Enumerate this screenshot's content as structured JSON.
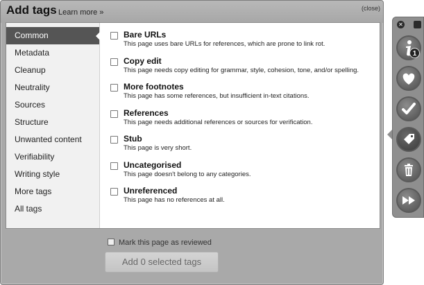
{
  "panel": {
    "title": "Add tags",
    "learn_more": "Learn more »",
    "close_label": "(close)"
  },
  "menu": {
    "items": [
      {
        "label": "Common",
        "active": true
      },
      {
        "label": "Metadata"
      },
      {
        "label": "Cleanup"
      },
      {
        "label": "Neutrality"
      },
      {
        "label": "Sources"
      },
      {
        "label": "Structure"
      },
      {
        "label": "Unwanted content"
      },
      {
        "label": "Verifiability"
      },
      {
        "label": "Writing style"
      },
      {
        "label": "More tags"
      },
      {
        "label": "All tags"
      }
    ]
  },
  "tags": [
    {
      "name": "Bare URLs",
      "desc": "This page uses bare URLs for references, which are prone to link rot."
    },
    {
      "name": "Copy edit",
      "desc": "This page needs copy editing for grammar, style, cohesion, tone, and/or spelling."
    },
    {
      "name": "More footnotes",
      "desc": "This page has some references, but insufficient in-text citations."
    },
    {
      "name": "References",
      "desc": "This page needs additional references or sources for verification."
    },
    {
      "name": "Stub",
      "desc": "This page is very short."
    },
    {
      "name": "Uncategorised",
      "desc": "This page doesn't belong to any categories."
    },
    {
      "name": "Unreferenced",
      "desc": "This page has no references at all."
    }
  ],
  "footer": {
    "mark_reviewed": "Mark this page as reviewed",
    "add_button": "Add 0 selected tags"
  },
  "toolbar": {
    "info_badge_count": "1",
    "buttons": [
      "info-icon",
      "heart-icon",
      "checkmark-icon",
      "tag-icon",
      "trash-icon",
      "fast-forward-icon"
    ]
  }
}
